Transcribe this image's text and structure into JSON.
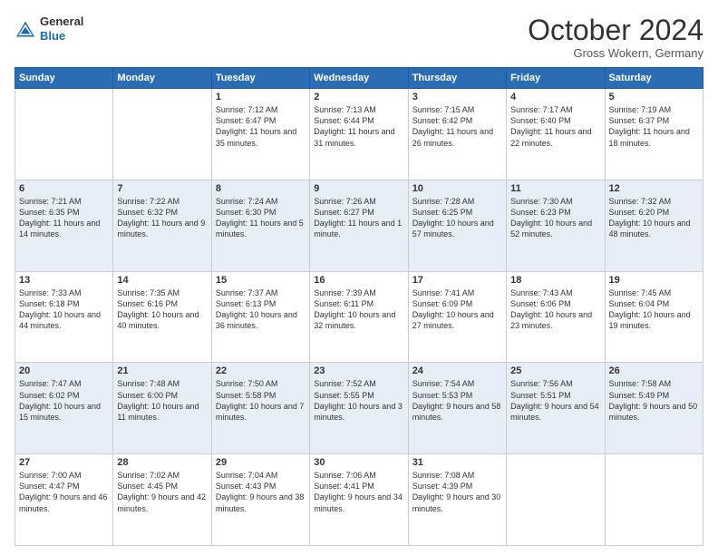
{
  "header": {
    "logo_line1": "General",
    "logo_line2": "Blue",
    "month_title": "October 2024",
    "location": "Gross Wokern, Germany"
  },
  "calendar": {
    "headers": [
      "Sunday",
      "Monday",
      "Tuesday",
      "Wednesday",
      "Thursday",
      "Friday",
      "Saturday"
    ],
    "rows": [
      [
        {
          "day": "",
          "sunrise": "",
          "sunset": "",
          "daylight": ""
        },
        {
          "day": "",
          "sunrise": "",
          "sunset": "",
          "daylight": ""
        },
        {
          "day": "1",
          "sunrise": "Sunrise: 7:12 AM",
          "sunset": "Sunset: 6:47 PM",
          "daylight": "Daylight: 11 hours and 35 minutes."
        },
        {
          "day": "2",
          "sunrise": "Sunrise: 7:13 AM",
          "sunset": "Sunset: 6:44 PM",
          "daylight": "Daylight: 11 hours and 31 minutes."
        },
        {
          "day": "3",
          "sunrise": "Sunrise: 7:15 AM",
          "sunset": "Sunset: 6:42 PM",
          "daylight": "Daylight: 11 hours and 26 minutes."
        },
        {
          "day": "4",
          "sunrise": "Sunrise: 7:17 AM",
          "sunset": "Sunset: 6:40 PM",
          "daylight": "Daylight: 11 hours and 22 minutes."
        },
        {
          "day": "5",
          "sunrise": "Sunrise: 7:19 AM",
          "sunset": "Sunset: 6:37 PM",
          "daylight": "Daylight: 11 hours and 18 minutes."
        }
      ],
      [
        {
          "day": "6",
          "sunrise": "Sunrise: 7:21 AM",
          "sunset": "Sunset: 6:35 PM",
          "daylight": "Daylight: 11 hours and 14 minutes."
        },
        {
          "day": "7",
          "sunrise": "Sunrise: 7:22 AM",
          "sunset": "Sunset: 6:32 PM",
          "daylight": "Daylight: 11 hours and 9 minutes."
        },
        {
          "day": "8",
          "sunrise": "Sunrise: 7:24 AM",
          "sunset": "Sunset: 6:30 PM",
          "daylight": "Daylight: 11 hours and 5 minutes."
        },
        {
          "day": "9",
          "sunrise": "Sunrise: 7:26 AM",
          "sunset": "Sunset: 6:27 PM",
          "daylight": "Daylight: 11 hours and 1 minute."
        },
        {
          "day": "10",
          "sunrise": "Sunrise: 7:28 AM",
          "sunset": "Sunset: 6:25 PM",
          "daylight": "Daylight: 10 hours and 57 minutes."
        },
        {
          "day": "11",
          "sunrise": "Sunrise: 7:30 AM",
          "sunset": "Sunset: 6:23 PM",
          "daylight": "Daylight: 10 hours and 52 minutes."
        },
        {
          "day": "12",
          "sunrise": "Sunrise: 7:32 AM",
          "sunset": "Sunset: 6:20 PM",
          "daylight": "Daylight: 10 hours and 48 minutes."
        }
      ],
      [
        {
          "day": "13",
          "sunrise": "Sunrise: 7:33 AM",
          "sunset": "Sunset: 6:18 PM",
          "daylight": "Daylight: 10 hours and 44 minutes."
        },
        {
          "day": "14",
          "sunrise": "Sunrise: 7:35 AM",
          "sunset": "Sunset: 6:16 PM",
          "daylight": "Daylight: 10 hours and 40 minutes."
        },
        {
          "day": "15",
          "sunrise": "Sunrise: 7:37 AM",
          "sunset": "Sunset: 6:13 PM",
          "daylight": "Daylight: 10 hours and 36 minutes."
        },
        {
          "day": "16",
          "sunrise": "Sunrise: 7:39 AM",
          "sunset": "Sunset: 6:11 PM",
          "daylight": "Daylight: 10 hours and 32 minutes."
        },
        {
          "day": "17",
          "sunrise": "Sunrise: 7:41 AM",
          "sunset": "Sunset: 6:09 PM",
          "daylight": "Daylight: 10 hours and 27 minutes."
        },
        {
          "day": "18",
          "sunrise": "Sunrise: 7:43 AM",
          "sunset": "Sunset: 6:06 PM",
          "daylight": "Daylight: 10 hours and 23 minutes."
        },
        {
          "day": "19",
          "sunrise": "Sunrise: 7:45 AM",
          "sunset": "Sunset: 6:04 PM",
          "daylight": "Daylight: 10 hours and 19 minutes."
        }
      ],
      [
        {
          "day": "20",
          "sunrise": "Sunrise: 7:47 AM",
          "sunset": "Sunset: 6:02 PM",
          "daylight": "Daylight: 10 hours and 15 minutes."
        },
        {
          "day": "21",
          "sunrise": "Sunrise: 7:48 AM",
          "sunset": "Sunset: 6:00 PM",
          "daylight": "Daylight: 10 hours and 11 minutes."
        },
        {
          "day": "22",
          "sunrise": "Sunrise: 7:50 AM",
          "sunset": "Sunset: 5:58 PM",
          "daylight": "Daylight: 10 hours and 7 minutes."
        },
        {
          "day": "23",
          "sunrise": "Sunrise: 7:52 AM",
          "sunset": "Sunset: 5:55 PM",
          "daylight": "Daylight: 10 hours and 3 minutes."
        },
        {
          "day": "24",
          "sunrise": "Sunrise: 7:54 AM",
          "sunset": "Sunset: 5:53 PM",
          "daylight": "Daylight: 9 hours and 58 minutes."
        },
        {
          "day": "25",
          "sunrise": "Sunrise: 7:56 AM",
          "sunset": "Sunset: 5:51 PM",
          "daylight": "Daylight: 9 hours and 54 minutes."
        },
        {
          "day": "26",
          "sunrise": "Sunrise: 7:58 AM",
          "sunset": "Sunset: 5:49 PM",
          "daylight": "Daylight: 9 hours and 50 minutes."
        }
      ],
      [
        {
          "day": "27",
          "sunrise": "Sunrise: 7:00 AM",
          "sunset": "Sunset: 4:47 PM",
          "daylight": "Daylight: 9 hours and 46 minutes."
        },
        {
          "day": "28",
          "sunrise": "Sunrise: 7:02 AM",
          "sunset": "Sunset: 4:45 PM",
          "daylight": "Daylight: 9 hours and 42 minutes."
        },
        {
          "day": "29",
          "sunrise": "Sunrise: 7:04 AM",
          "sunset": "Sunset: 4:43 PM",
          "daylight": "Daylight: 9 hours and 38 minutes."
        },
        {
          "day": "30",
          "sunrise": "Sunrise: 7:06 AM",
          "sunset": "Sunset: 4:41 PM",
          "daylight": "Daylight: 9 hours and 34 minutes."
        },
        {
          "day": "31",
          "sunrise": "Sunrise: 7:08 AM",
          "sunset": "Sunset: 4:39 PM",
          "daylight": "Daylight: 9 hours and 30 minutes."
        },
        {
          "day": "",
          "sunrise": "",
          "sunset": "",
          "daylight": ""
        },
        {
          "day": "",
          "sunrise": "",
          "sunset": "",
          "daylight": ""
        }
      ]
    ]
  }
}
